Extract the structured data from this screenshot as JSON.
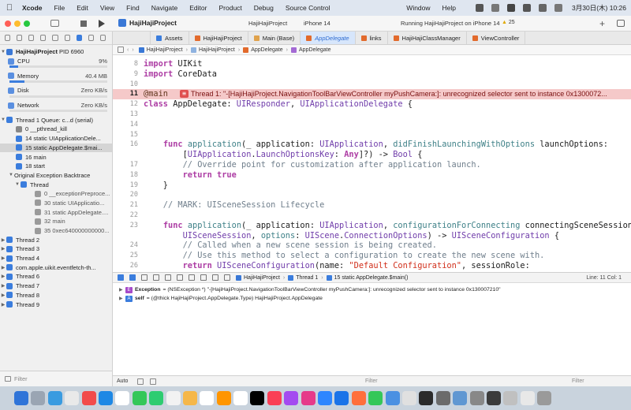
{
  "menubar": {
    "app": "Xcode",
    "items": [
      "File",
      "Edit",
      "View",
      "Find",
      "Navigate",
      "Editor",
      "Product",
      "Debug",
      "Source Control"
    ],
    "right_items": [
      "Window",
      "Help"
    ],
    "clock": "3月30日(木) 10:26"
  },
  "toolbar": {
    "project": "HajiHajiProject",
    "scheme": "HajiHajiProject",
    "device": "iPhone 14",
    "status": "Running HajiHajiProject on iPhone 14",
    "warnings": "25"
  },
  "navigator": {
    "process_name": "HajiHajiProject",
    "process_pid": "PID 6960",
    "gauges": [
      {
        "label": "CPU",
        "value": "9%",
        "fraction": 0.09,
        "color": "#3b7ddd"
      },
      {
        "label": "Memory",
        "value": "40.4 MB",
        "fraction": 0.15,
        "color": "#3b7ddd"
      },
      {
        "label": "Disk",
        "value": "Zero KB/s",
        "fraction": 0,
        "color": "#3b7ddd"
      },
      {
        "label": "Network",
        "value": "Zero KB/s",
        "fraction": 0,
        "color": "#3b7ddd"
      }
    ],
    "thread1": "Thread 1 Queue: c...d (serial)",
    "frames": [
      {
        "label": "0 __pthread_kill",
        "selected": false
      },
      {
        "label": "14 static UIApplicationDele...",
        "selected": false
      },
      {
        "label": "15 static AppDelegate.$mai...",
        "selected": true
      },
      {
        "label": "16 main",
        "selected": false
      },
      {
        "label": "18 start",
        "selected": false
      }
    ],
    "backtrace_title": "Original Exception Backtrace",
    "backtrace_thread": "Thread",
    "backtrace_frames": [
      "0 __exceptionPreproce...",
      "30 static UIApplicatio...",
      "31 static AppDelegate....",
      "32 main",
      "35 0xec640000000000..."
    ],
    "other_threads": [
      "Thread 2",
      "Thread 3",
      "Thread 4",
      "com.apple.uikit.eventfetch-th...",
      "Thread 6",
      "Thread 7",
      "Thread 8",
      "Thread 9"
    ],
    "filter_placeholder": "Filter"
  },
  "tabs": [
    {
      "label": "",
      "active": false,
      "color": "#8a8a8a"
    },
    {
      "label": "Assets",
      "active": false,
      "color": "#3b7ddd"
    },
    {
      "label": "HajiHajiProject",
      "active": false,
      "color": "#e26a2c"
    },
    {
      "label": "Main (Base)",
      "active": false,
      "color": "#e0a24c"
    },
    {
      "label": "AppDelegate",
      "active": true,
      "color": "#e26a2c"
    },
    {
      "label": "links",
      "active": false,
      "color": "#e26a2c"
    },
    {
      "label": "HajiHajiClassManager",
      "active": false,
      "color": "#e26a2c"
    },
    {
      "label": "ViewController",
      "active": false,
      "color": "#e26a2c"
    }
  ],
  "jumpbar": [
    "HajiHajiProject",
    "HajiHajiProject",
    "AppDelegate",
    "AppDelegate"
  ],
  "code_lines": [
    {
      "n": "8",
      "tokens": [
        [
          "kw",
          "import"
        ],
        [
          "pl",
          " UIKit"
        ]
      ]
    },
    {
      "n": "9",
      "tokens": [
        [
          "kw",
          "import"
        ],
        [
          "pl",
          " CoreData"
        ]
      ]
    },
    {
      "n": "10",
      "tokens": []
    },
    {
      "n": "11",
      "error": true,
      "tokens": [
        [
          "at",
          "@main"
        ]
      ]
    },
    {
      "n": "12",
      "tokens": [
        [
          "kw",
          "class"
        ],
        [
          "pl",
          " AppDelegate: "
        ],
        [
          "ty",
          "UIResponder"
        ],
        [
          "pl",
          ", "
        ],
        [
          "ty",
          "UIApplicationDelegate"
        ],
        [
          "pl",
          " {"
        ]
      ]
    },
    {
      "n": "13",
      "tokens": []
    },
    {
      "n": "14",
      "tokens": []
    },
    {
      "n": "15",
      "tokens": []
    },
    {
      "n": "16",
      "tokens": [
        [
          "pl",
          "    "
        ],
        [
          "kw",
          "func"
        ],
        [
          "pl",
          " "
        ],
        [
          "fn",
          "application"
        ],
        [
          "pl",
          "(_ application: "
        ],
        [
          "ty",
          "UIApplication"
        ],
        [
          "pl",
          ", "
        ],
        [
          "fn",
          "didFinishLaunchingWithOptions"
        ],
        [
          "pl",
          " launchOptions:"
        ]
      ]
    },
    {
      "n": "",
      "tokens": [
        [
          "pl",
          "        ["
        ],
        [
          "ty",
          "UIApplication"
        ],
        [
          "pl",
          "."
        ],
        [
          "ty",
          "LaunchOptionsKey"
        ],
        [
          "pl",
          ": "
        ],
        [
          "kw",
          "Any"
        ],
        [
          "pl",
          "]?) -> "
        ],
        [
          "ty",
          "Bool"
        ],
        [
          "pl",
          " {"
        ]
      ]
    },
    {
      "n": "17",
      "tokens": [
        [
          "cm",
          "        // Override point for customization after application launch."
        ]
      ]
    },
    {
      "n": "18",
      "tokens": [
        [
          "pl",
          "        "
        ],
        [
          "kw",
          "return"
        ],
        [
          "pl",
          " "
        ],
        [
          "kw",
          "true"
        ]
      ]
    },
    {
      "n": "19",
      "tokens": [
        [
          "pl",
          "    }"
        ]
      ]
    },
    {
      "n": "20",
      "tokens": []
    },
    {
      "n": "21",
      "tokens": [
        [
          "cm",
          "    // MARK: UISceneSession Lifecycle"
        ]
      ]
    },
    {
      "n": "22",
      "tokens": []
    },
    {
      "n": "23",
      "tokens": [
        [
          "pl",
          "    "
        ],
        [
          "kw",
          "func"
        ],
        [
          "pl",
          " "
        ],
        [
          "fn",
          "application"
        ],
        [
          "pl",
          "(_ application: "
        ],
        [
          "ty",
          "UIApplication"
        ],
        [
          "pl",
          ", "
        ],
        [
          "fn",
          "configurationForConnecting"
        ],
        [
          "pl",
          " connectingSceneSession:"
        ]
      ]
    },
    {
      "n": "",
      "tokens": [
        [
          "pl",
          "        "
        ],
        [
          "ty",
          "UISceneSession"
        ],
        [
          "pl",
          ", "
        ],
        [
          "fn",
          "options"
        ],
        [
          "pl",
          ": "
        ],
        [
          "ty",
          "UIScene"
        ],
        [
          "pl",
          "."
        ],
        [
          "ty",
          "ConnectionOptions"
        ],
        [
          "pl",
          ") -> "
        ],
        [
          "ty",
          "UISceneConfiguration"
        ],
        [
          "pl",
          " {"
        ]
      ]
    },
    {
      "n": "24",
      "tokens": [
        [
          "cm",
          "        // Called when a new scene session is being created."
        ]
      ]
    },
    {
      "n": "25",
      "tokens": [
        [
          "cm",
          "        // Use this method to select a configuration to create the new scene with."
        ]
      ]
    },
    {
      "n": "26",
      "tokens": [
        [
          "pl",
          "        "
        ],
        [
          "kw",
          "return"
        ],
        [
          "pl",
          " "
        ],
        [
          "ty",
          "UISceneConfiguration"
        ],
        [
          "pl",
          "(name: "
        ],
        [
          "st",
          "\"Default Configuration\""
        ],
        [
          "pl",
          ", sessionRole:"
        ]
      ]
    }
  ],
  "error_message": "Thread 1: \"-[HajiHajiProject.NavigationToolBarViewController myPushCamera:]: unrecognized selector sent to instance 0x1300072...",
  "debugbar": {
    "crumbs": [
      "HajiHajiProject",
      "Thread 1",
      "15 static AppDelegate.$main()"
    ],
    "position": "Line: 11  Col: 1"
  },
  "variables": [
    {
      "badge": "E",
      "badge_color": "#a64ac9",
      "name": "Exception",
      "value": "= (NSException *) \"-[HajiHajiProject.NavigationToolBarViewController myPushCamera:]: unrecognized selector sent to instance 0x130007210\""
    },
    {
      "badge": "A",
      "badge_color": "#3b7ddd",
      "name": "self",
      "value": "= (@thick HajiHajiProject.AppDelegate.Type) HajiHajiProject.AppDelegate"
    }
  ],
  "bottombar": {
    "mode": "Auto",
    "filter_placeholder": "Filter",
    "filter2_placeholder": "Filter"
  },
  "dock_colors": [
    "#2f74d8",
    "#9aa5b3",
    "#3a9be0",
    "#e9e9e9",
    "#f24b4b",
    "#1e88e5",
    "#ffffff",
    "#34c759",
    "#2ecc71",
    "#f2f2f2",
    "#f5b74a",
    "#ffffff",
    "#ff9500",
    "#ffffff",
    "#000000",
    "#fa3f56",
    "#a44af0",
    "#e63b8a",
    "#2d86ff",
    "#1a73e8",
    "#ff6f3c",
    "#34c759",
    "#4a90e2",
    "#e0e0e0",
    "#2b2b2b",
    "#6b6b6b",
    "#5f97d2",
    "#888888",
    "#3b3b3b",
    "#c0c0c0",
    "#e8e8e8",
    "#9a9a9a"
  ]
}
